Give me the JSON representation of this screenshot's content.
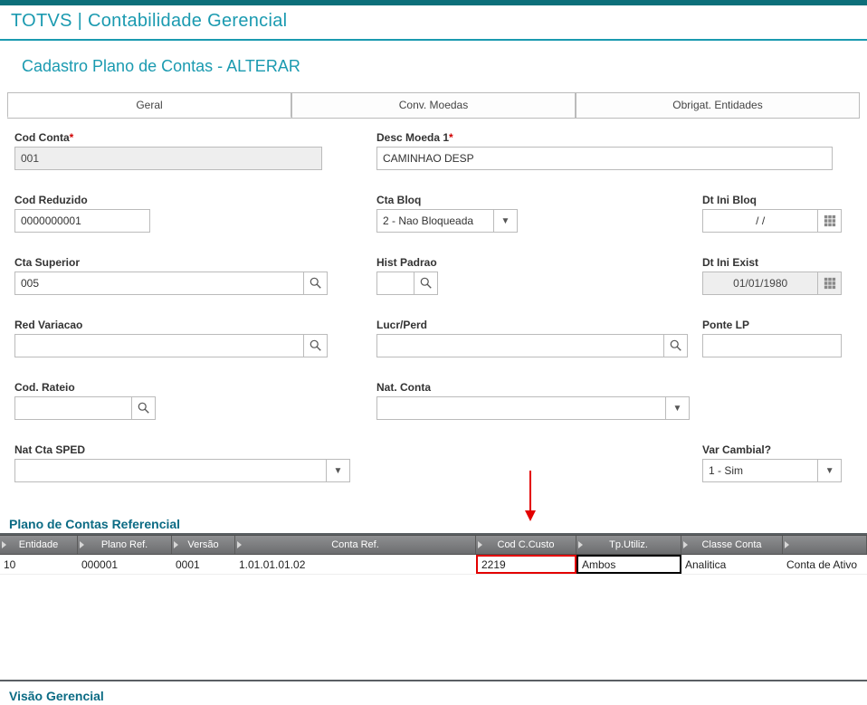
{
  "app_title": "TOTVS | Contabilidade Gerencial",
  "page_title": "Cadastro Plano de Contas - ALTERAR",
  "tabs": {
    "geral": "Geral",
    "moedas": "Conv. Moedas",
    "obrigat": "Obrigat. Entidades"
  },
  "fields": {
    "cod_conta": {
      "label": "Cod Conta",
      "value": "001"
    },
    "desc_moeda1": {
      "label": "Desc Moeda 1",
      "value": "CAMINHAO DESP"
    },
    "cod_reduzido": {
      "label": "Cod Reduzido",
      "value": "0000000001"
    },
    "cta_bloq": {
      "label": "Cta Bloq",
      "value": "2 - Nao Bloqueada"
    },
    "dt_ini_bloq": {
      "label": "Dt Ini Bloq",
      "value": "/  /"
    },
    "cta_superior": {
      "label": "Cta Superior",
      "value": "005"
    },
    "hist_padrao": {
      "label": "Hist Padrao",
      "value": ""
    },
    "dt_ini_exist": {
      "label": "Dt Ini Exist",
      "value": "01/01/1980"
    },
    "red_variacao": {
      "label": "Red Variacao",
      "value": ""
    },
    "lucr_perd": {
      "label": "Lucr/Perd",
      "value": ""
    },
    "ponte_lp": {
      "label": "Ponte LP",
      "value": ""
    },
    "cod_rateio": {
      "label": "Cod. Rateio",
      "value": ""
    },
    "nat_conta": {
      "label": "Nat. Conta",
      "value": ""
    },
    "nat_cta_sped": {
      "label": "Nat Cta SPED",
      "value": ""
    },
    "var_cambial": {
      "label": "Var Cambial?",
      "value": "1 - Sim"
    }
  },
  "section_plano_ref": "Plano de Contas Referencial",
  "section_visao": "Visão Gerencial",
  "grid": {
    "headers": {
      "entidade": "Entidade",
      "plano_ref": "Plano Ref.",
      "versao": "Versão",
      "conta_ref": "Conta Ref.",
      "cod_ccusto": "Cod C.Custo",
      "tp_utiliz": "Tp.Utiliz.",
      "classe_conta": "Classe Conta"
    },
    "row": {
      "entidade": "10",
      "plano_ref": "000001",
      "versao": "0001",
      "conta_ref": "1.01.01.01.02",
      "cod_ccusto": "2219",
      "tp_utiliz": "Ambos",
      "classe_conta": "Analitica",
      "extra": "Conta de Ativo"
    }
  }
}
